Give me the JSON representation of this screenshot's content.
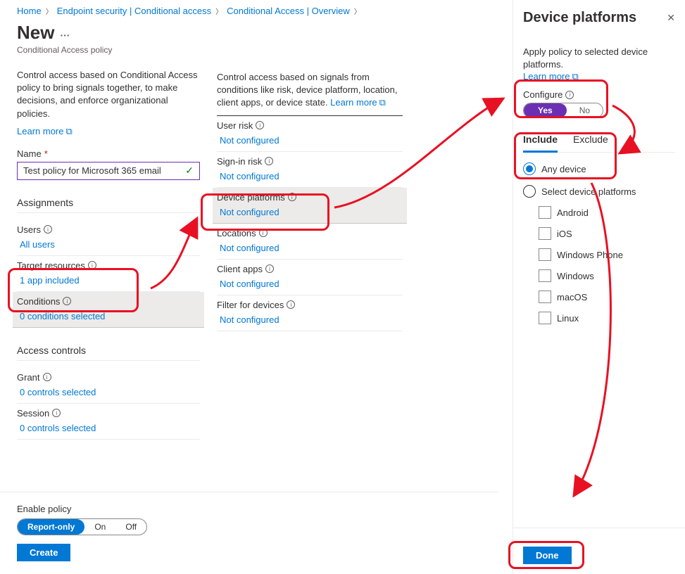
{
  "breadcrumb": [
    "Home",
    "Endpoint security | Conditional access",
    "Conditional Access | Overview"
  ],
  "page_title": "New",
  "page_subtitle": "Conditional Access policy",
  "col1": {
    "desc": "Control access based on Conditional Access policy to bring signals together, to make decisions, and enforce organizational policies.",
    "learn_more": "Learn more",
    "name_label": "Name",
    "name_value": "Test policy for Microsoft 365 email",
    "assignments_head": "Assignments",
    "users_label": "Users",
    "users_value": "All users",
    "target_label": "Target resources",
    "target_value": "1 app included",
    "conditions_label": "Conditions",
    "conditions_value": "0 conditions selected",
    "access_head": "Access controls",
    "grant_label": "Grant",
    "grant_value": "0 controls selected",
    "session_label": "Session",
    "session_value": "0 controls selected"
  },
  "col2": {
    "desc_pre": "Control access based on signals from conditions like risk, device platform, location, client apps, or device state. ",
    "learn_more": "Learn more",
    "items": [
      {
        "label": "User risk",
        "value": "Not configured"
      },
      {
        "label": "Sign-in risk",
        "value": "Not configured"
      },
      {
        "label": "Device platforms",
        "value": "Not configured"
      },
      {
        "label": "Locations",
        "value": "Not configured"
      },
      {
        "label": "Client apps",
        "value": "Not configured"
      },
      {
        "label": "Filter for devices",
        "value": "Not configured"
      }
    ]
  },
  "footer": {
    "enable_label": "Enable policy",
    "options": [
      "Report-only",
      "On",
      "Off"
    ],
    "create": "Create"
  },
  "panel": {
    "title": "Device platforms",
    "desc": "Apply policy to selected device platforms.",
    "learn_more": "Learn more",
    "configure_label": "Configure",
    "yes": "Yes",
    "no": "No",
    "tab_include": "Include",
    "tab_exclude": "Exclude",
    "radio_any": "Any device",
    "radio_select": "Select device platforms",
    "platforms": [
      "Android",
      "iOS",
      "Windows Phone",
      "Windows",
      "macOS",
      "Linux"
    ],
    "done": "Done"
  }
}
